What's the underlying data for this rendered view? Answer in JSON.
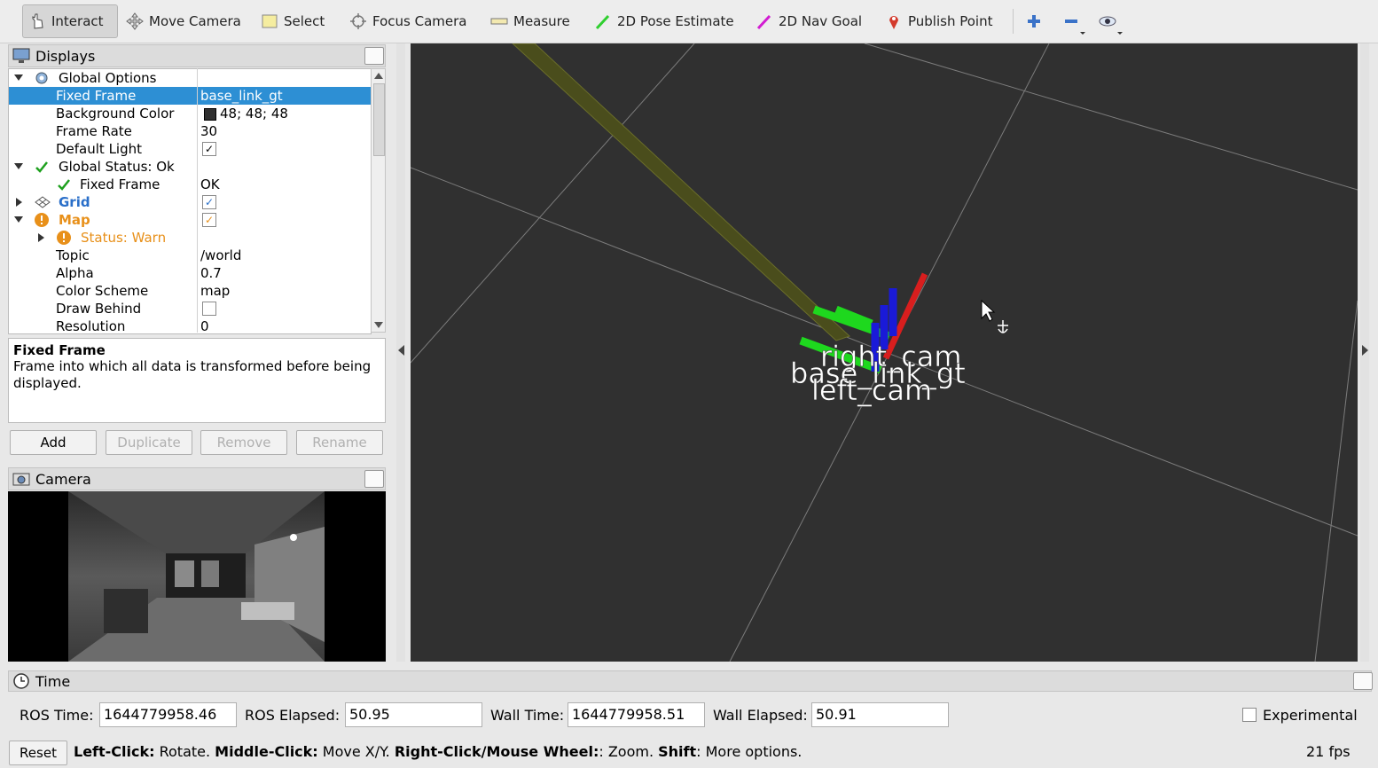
{
  "toolbar": {
    "tools": [
      {
        "label": "Interact",
        "icon": "hand-pointer-icon"
      },
      {
        "label": "Move Camera",
        "icon": "move-arrows-icon"
      },
      {
        "label": "Select",
        "icon": "select-box-icon"
      },
      {
        "label": "Focus Camera",
        "icon": "focus-target-icon"
      },
      {
        "label": "Measure",
        "icon": "ruler-icon"
      },
      {
        "label": "2D Pose Estimate",
        "icon": "green-arrow-icon"
      },
      {
        "label": "2D Nav Goal",
        "icon": "magenta-arrow-icon"
      },
      {
        "label": "Publish Point",
        "icon": "map-pin-icon"
      }
    ],
    "extra_icons": [
      "plus-icon",
      "minus-icon",
      "eye-icon"
    ]
  },
  "displays": {
    "title": "Displays",
    "rows": [
      {
        "label": "Global Options",
        "value": ""
      },
      {
        "label": "Fixed Frame",
        "value": "base_link_gt"
      },
      {
        "label": "Background Color",
        "value": "48; 48; 48"
      },
      {
        "label": "Frame Rate",
        "value": "30"
      },
      {
        "label": "Default Light",
        "value": "✓"
      },
      {
        "label": "Global Status: Ok",
        "value": ""
      },
      {
        "label": "Fixed Frame",
        "value": "OK"
      },
      {
        "label": "Grid",
        "value": "✓"
      },
      {
        "label": "Map",
        "value": "✓"
      },
      {
        "label": "Status: Warn",
        "value": ""
      },
      {
        "label": "Topic",
        "value": "/world"
      },
      {
        "label": "Alpha",
        "value": "0.7"
      },
      {
        "label": "Color Scheme",
        "value": "map"
      },
      {
        "label": "Draw Behind",
        "value": ""
      },
      {
        "label": "Resolution",
        "value": "0"
      }
    ],
    "description_title": "Fixed Frame",
    "description_text": "Frame into which all data is transformed before being displayed.",
    "buttons": {
      "add": "Add",
      "duplicate": "Duplicate",
      "remove": "Remove",
      "rename": "Rename"
    }
  },
  "camera": {
    "title": "Camera"
  },
  "viewport": {
    "frame_labels": [
      "right_cam",
      "base_link_gt",
      "left_cam"
    ],
    "background_color": "#303030"
  },
  "time": {
    "title": "Time",
    "ros_time_label": "ROS Time:",
    "ros_time": "1644779958.46",
    "ros_elapsed_label": "ROS Elapsed:",
    "ros_elapsed": "50.95",
    "wall_time_label": "Wall Time:",
    "wall_time": "1644779958.51",
    "wall_elapsed_label": "Wall Elapsed:",
    "wall_elapsed": "50.91",
    "experimental_label": "Experimental"
  },
  "statusbar": {
    "reset": "Reset",
    "hint_b1": "Left-Click:",
    "hint_t1": " Rotate. ",
    "hint_b2": "Middle-Click:",
    "hint_t2": " Move X/Y. ",
    "hint_b3": "Right-Click/Mouse Wheel:",
    "hint_t3": ": Zoom. ",
    "hint_b4": "Shift",
    "hint_t4": ": More options.",
    "fps": "21 fps"
  },
  "colors": {
    "selection": "#2d8fd4",
    "warn": "#e8901a",
    "grid_blue": "#2a6fc9"
  }
}
